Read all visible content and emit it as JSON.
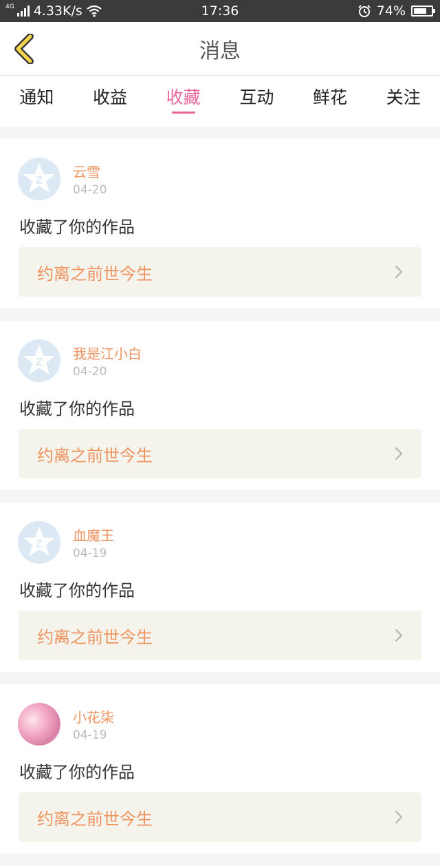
{
  "status_bar": {
    "network_tag": "4G",
    "speed": "4.33K/s",
    "time": "17:36",
    "battery": "74%",
    "battery_level": 0.74
  },
  "header": {
    "title": "消息",
    "back_icon": "chevron-left-icon"
  },
  "tabs": [
    {
      "label": "通知",
      "active": false
    },
    {
      "label": "收益",
      "active": false
    },
    {
      "label": "收藏",
      "active": true
    },
    {
      "label": "互动",
      "active": false
    },
    {
      "label": "鲜花",
      "active": false
    },
    {
      "label": "关注",
      "active": false
    }
  ],
  "colors": {
    "accent": "#e9679b",
    "name_orange": "#ef935f",
    "link_bg": "#f4f3ec"
  },
  "messages": [
    {
      "username": "云雪",
      "date": "04-20",
      "action": "收藏了你的作品",
      "work_title": "约离之前世今生",
      "avatar": "default-avatar-icon"
    },
    {
      "username": "我是江小白",
      "date": "04-20",
      "action": "收藏了你的作品",
      "work_title": "约离之前世今生",
      "avatar": "default-avatar-icon"
    },
    {
      "username": "血魔王",
      "date": "04-19",
      "action": "收藏了你的作品",
      "work_title": "约离之前世今生",
      "avatar": "default-avatar-icon"
    },
    {
      "username": "小花柒",
      "date": "04-19",
      "action": "收藏了你的作品",
      "work_title": "约离之前世今生",
      "avatar": "photo-avatar"
    }
  ]
}
